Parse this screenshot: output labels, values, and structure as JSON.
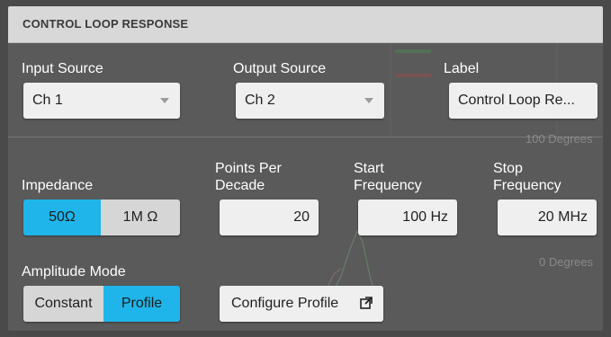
{
  "dialog": {
    "title": "CONTROL LOOP RESPONSE"
  },
  "input_source": {
    "label": "Input Source",
    "value": "Ch 1"
  },
  "output_source": {
    "label": "Output Source",
    "value": "Ch 2"
  },
  "label_field": {
    "label": "Label",
    "value": "Control Loop Re..."
  },
  "impedance": {
    "label": "Impedance",
    "options": [
      "50Ω",
      "1M Ω"
    ],
    "selected": "50Ω"
  },
  "points_per_decade": {
    "label_line1": "Points Per",
    "label_line2": "Decade",
    "value": "20"
  },
  "start_frequency": {
    "label_line1": "Start",
    "label_line2": "Frequency",
    "value": "100 Hz"
  },
  "stop_frequency": {
    "label_line1": "Stop",
    "label_line2": "Frequency",
    "value": "20 MHz"
  },
  "amplitude_mode": {
    "label": "Amplitude Mode",
    "options": [
      "Constant",
      "Profile"
    ],
    "selected": "Profile"
  },
  "configure_profile": {
    "label": "Configure Profile"
  },
  "background": {
    "degrees_top": "100 Degrees",
    "degrees_mid": "0 Degrees"
  },
  "colors": {
    "accent": "#1fb5ea",
    "panel": "#5a5a5a",
    "titlebar": "#d8d8d8"
  }
}
